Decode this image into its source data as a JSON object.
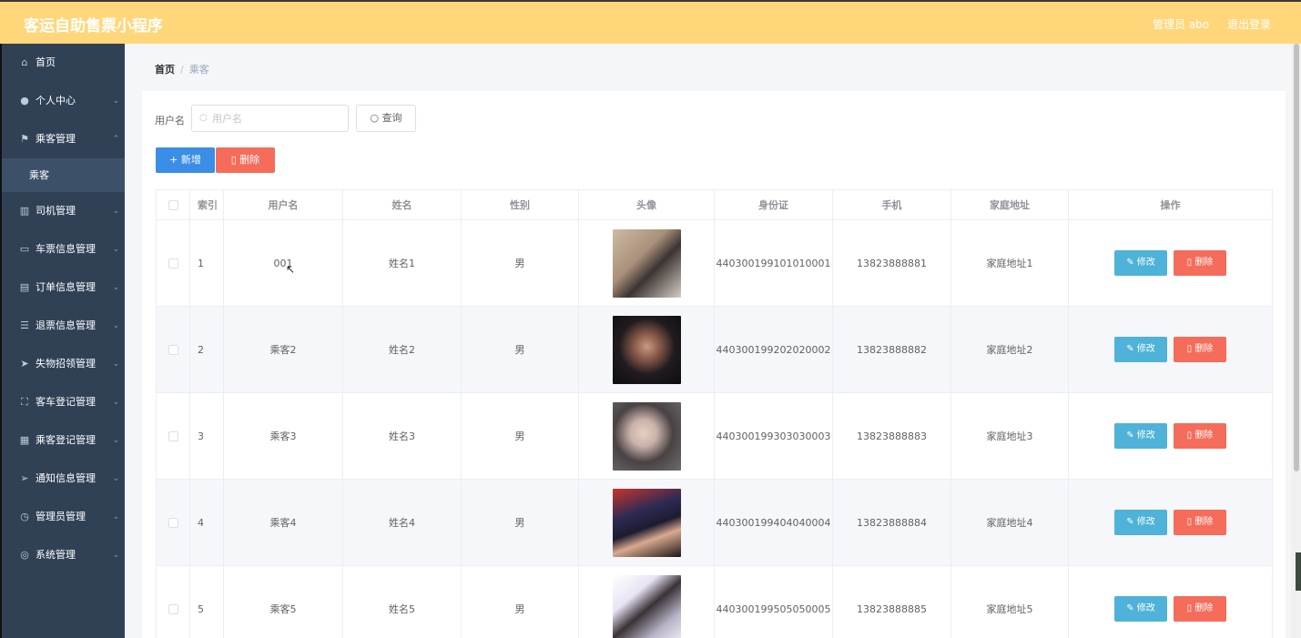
{
  "header": {
    "title": "客运自助售票小程序",
    "admin_label": "管理员 abo",
    "logout_label": "退出登录"
  },
  "sidebar": {
    "items": [
      {
        "label": "首页",
        "icon": "home-icon",
        "glyph": "⌂",
        "chevron": ""
      },
      {
        "label": "个人中心",
        "icon": "user-icon",
        "glyph": "●",
        "chevron": "⌄"
      },
      {
        "label": "乘客管理",
        "icon": "flag-icon",
        "glyph": "⚑",
        "chevron": "⌃"
      },
      {
        "label": "司机管理",
        "icon": "chart-icon",
        "glyph": "▥",
        "chevron": "⌄"
      },
      {
        "label": "车票信息管理",
        "icon": "message-icon",
        "glyph": "▭",
        "chevron": "⌄"
      },
      {
        "label": "订单信息管理",
        "icon": "clipboard-icon",
        "glyph": "▤",
        "chevron": "⌄"
      },
      {
        "label": "退票信息管理",
        "icon": "list-icon",
        "glyph": "☰",
        "chevron": "⌄"
      },
      {
        "label": "失物招领管理",
        "icon": "send-icon",
        "glyph": "➤",
        "chevron": "⌄"
      },
      {
        "label": "客车登记管理",
        "icon": "fullscreen-icon",
        "glyph": "⛶",
        "chevron": "⌄"
      },
      {
        "label": "乘客登记管理",
        "icon": "grid-icon",
        "glyph": "▦",
        "chevron": "⌄"
      },
      {
        "label": "通知信息管理",
        "icon": "position-icon",
        "glyph": "➢",
        "chevron": "⌄"
      },
      {
        "label": "管理员管理",
        "icon": "time-icon",
        "glyph": "◷",
        "chevron": "⌄"
      },
      {
        "label": "系统管理",
        "icon": "settings-icon",
        "glyph": "◎",
        "chevron": "⌄"
      }
    ],
    "active_sub": "乘客"
  },
  "breadcrumb": {
    "home": "首页",
    "separator": "/",
    "current": "乘客"
  },
  "search": {
    "label": "用户名",
    "placeholder": "用户名",
    "value": "",
    "query_label": "查询"
  },
  "actions": {
    "add_label": "新增",
    "delete_label": "删除"
  },
  "table": {
    "headers": [
      "索引",
      "用户名",
      "姓名",
      "性别",
      "头像",
      "身份证",
      "手机",
      "家庭地址",
      "操作"
    ],
    "edit_label": "修改",
    "delete_label": "删除",
    "rows": [
      {
        "index": "1",
        "username": "001",
        "name": "姓名1",
        "gender": "男",
        "id_card": "440300199101010001",
        "phone": "13823888881",
        "address": "家庭地址1"
      },
      {
        "index": "2",
        "username": "乘客2",
        "name": "姓名2",
        "gender": "男",
        "id_card": "440300199202020002",
        "phone": "13823888882",
        "address": "家庭地址2"
      },
      {
        "index": "3",
        "username": "乘客3",
        "name": "姓名3",
        "gender": "男",
        "id_card": "440300199303030003",
        "phone": "13823888883",
        "address": "家庭地址3"
      },
      {
        "index": "4",
        "username": "乘客4",
        "name": "姓名4",
        "gender": "男",
        "id_card": "440300199404040004",
        "phone": "13823888884",
        "address": "家庭地址4"
      },
      {
        "index": "5",
        "username": "乘客5",
        "name": "姓名5",
        "gender": "男",
        "id_card": "440300199505050005",
        "phone": "13823888885",
        "address": "家庭地址5"
      }
    ]
  },
  "colors": {
    "header_bg": "#ffd77a",
    "sidebar_bg": "#304156",
    "primary": "#3a8ee6",
    "danger": "#f56c5a",
    "info": "#4fb2d9"
  }
}
